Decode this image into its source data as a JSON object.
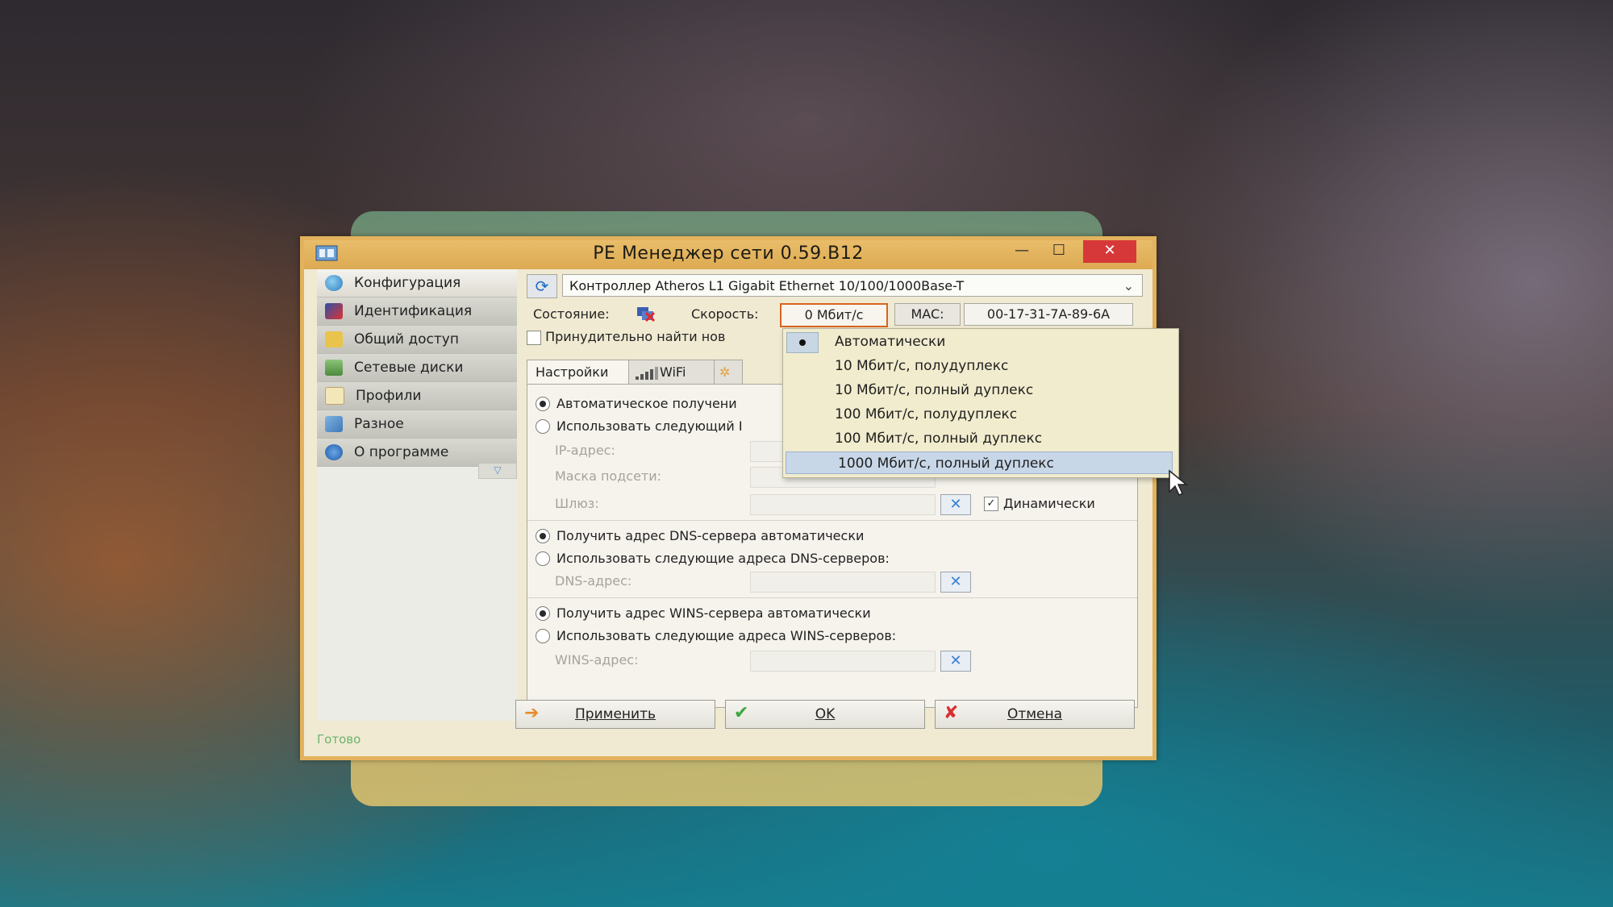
{
  "window": {
    "title": "PE Менеджер сети 0.59.B12",
    "minimize": "—",
    "maximize": "☐",
    "close": "✕"
  },
  "sidebar": {
    "items": [
      {
        "label": "Конфигурация",
        "icon": "globe-icon"
      },
      {
        "label": "Идентификация",
        "icon": "id-card-icon"
      },
      {
        "label": "Общий доступ",
        "icon": "folder-share-icon"
      },
      {
        "label": "Сетевые диски",
        "icon": "network-drive-icon"
      },
      {
        "label": "Профили",
        "icon": "profile-icon"
      },
      {
        "label": "Разное",
        "icon": "misc-icon"
      },
      {
        "label": "О программе",
        "icon": "help-icon"
      }
    ]
  },
  "adapter": {
    "name": "Контроллер Atheros L1 Gigabit Ethernet 10/100/1000Base-T"
  },
  "status": {
    "state_label": "Состояние:",
    "speed_label": "Скорость:",
    "speed_value": "0 Мбит/с",
    "mac_label": "MAC:",
    "mac_value": "00-17-31-7A-89-6A"
  },
  "force_label": "Принудительно найти нов",
  "tabs": [
    {
      "label": "Настройки IP"
    },
    {
      "label": "WiFi"
    }
  ],
  "ip": {
    "auto_label": "Автоматическое получени",
    "manual_label": "Использовать следующий I",
    "ip_label": "IP-адрес:",
    "mask_label": "Маска подсети:",
    "gateway_label": "Шлюз:",
    "dynamic_label": "Динамически"
  },
  "dns": {
    "auto_label": "Получить адрес DNS-сервера автоматически",
    "manual_label": "Использовать следующие адреса DNS-серверов:",
    "field_label": "DNS-адрес:"
  },
  "wins": {
    "auto_label": "Получить адрес WINS-сервера автоматически",
    "manual_label": "Использовать следующие адреса WINS-серверов:",
    "field_label": "WINS-адрес:"
  },
  "buttons": {
    "apply": "Применить",
    "ok": "OK",
    "cancel": "Отмена"
  },
  "statusbar": {
    "text": "Готово"
  },
  "speed_dropdown": {
    "selected_index": 0,
    "hover_index": 5,
    "options": [
      "Автоматически",
      "10 Мбит/с, полудуплекс",
      "10 Мбит/с, полный дуплекс",
      "100 Мбит/с, полудуплекс",
      "100 Мбит/с, полный дуплекс",
      "1000 Мбит/с, полный дуплекс"
    ]
  },
  "colors": {
    "title_bar": "#dcaa52",
    "close_button": "#d6383a",
    "speed_highlight": "#d8641e",
    "status_ready": "#6db36d",
    "dropdown_hover": "#c8d7e8"
  }
}
